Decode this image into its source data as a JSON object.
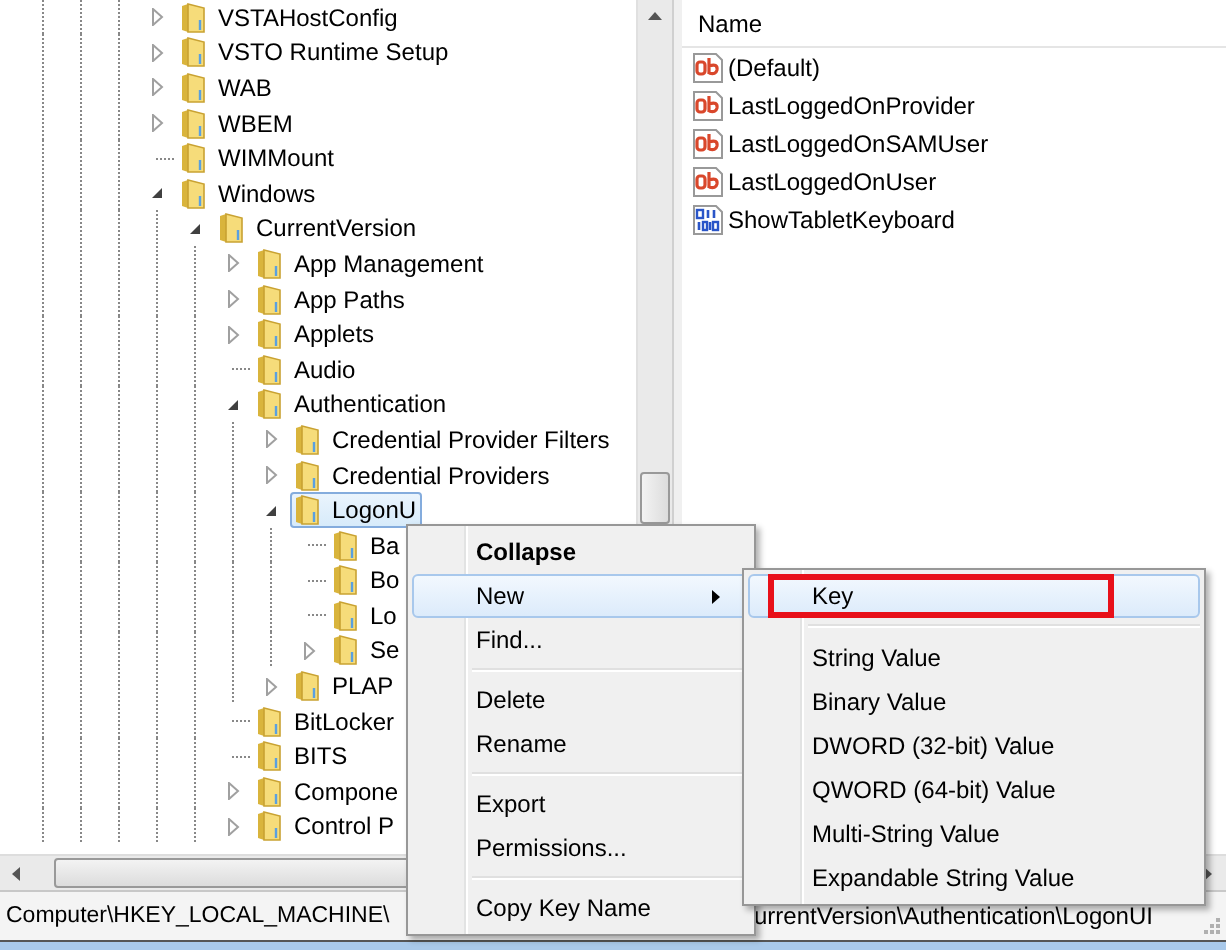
{
  "tree": [
    {
      "label": "VSTAHostConfig",
      "expanded": false,
      "selected": false
    },
    {
      "label": "VSTO Runtime Setup",
      "expanded": false,
      "selected": false
    },
    {
      "label": "WAB",
      "expanded": false,
      "selected": false
    },
    {
      "label": "WBEM",
      "expanded": false,
      "selected": false
    },
    {
      "label": "WIMMount",
      "selected": false
    },
    {
      "label": "Windows",
      "expanded": true,
      "selected": false,
      "children": [
        {
          "label": "CurrentVersion",
          "expanded": true,
          "selected": false,
          "children": [
            {
              "label": "App Management",
              "expanded": false,
              "selected": false
            },
            {
              "label": "App Paths",
              "expanded": false,
              "selected": false
            },
            {
              "label": "Applets",
              "expanded": false,
              "selected": false
            },
            {
              "label": "Audio",
              "selected": false
            },
            {
              "label": "Authentication",
              "expanded": true,
              "selected": false,
              "children": [
                {
                  "label": "Credential Provider Filters",
                  "expanded": false,
                  "selected": false
                },
                {
                  "label": "Credential Providers",
                  "expanded": false,
                  "selected": false
                },
                {
                  "label": "LogonU",
                  "expanded": true,
                  "selected": true,
                  "children": [
                    {
                      "label": "Ba",
                      "selected": false
                    },
                    {
                      "label": "Bo",
                      "selected": false
                    },
                    {
                      "label": "Lo",
                      "selected": false
                    },
                    {
                      "label": "Se",
                      "expanded": false,
                      "selected": false
                    }
                  ]
                },
                {
                  "label": "PLAP",
                  "expanded": false,
                  "selected": false
                }
              ]
            },
            {
              "label": "BitLocker",
              "selected": false
            },
            {
              "label": "BITS",
              "selected": false
            },
            {
              "label": "Compone",
              "expanded": false,
              "selected": false
            },
            {
              "label": "Control P",
              "expanded": false,
              "selected": false
            }
          ]
        }
      ]
    }
  ],
  "values": {
    "header": "Name",
    "rows": [
      {
        "name": "(Default)",
        "kind": "string"
      },
      {
        "name": "LastLoggedOnProvider",
        "kind": "string"
      },
      {
        "name": "LastLoggedOnSAMUser",
        "kind": "string"
      },
      {
        "name": "LastLoggedOnUser",
        "kind": "string"
      },
      {
        "name": "ShowTabletKeyboard",
        "kind": "dword"
      }
    ]
  },
  "context_menu": {
    "items": [
      {
        "kind": "item",
        "label": "Collapse",
        "default": true,
        "highlighted": false,
        "has_submenu": false
      },
      {
        "kind": "item",
        "label": "New",
        "default": false,
        "highlighted": true,
        "has_submenu": true
      },
      {
        "kind": "item",
        "label": "Find...",
        "default": false,
        "highlighted": false,
        "has_submenu": false
      },
      {
        "kind": "separator"
      },
      {
        "kind": "item",
        "label": "Delete",
        "default": false,
        "highlighted": false,
        "has_submenu": false
      },
      {
        "kind": "item",
        "label": "Rename",
        "default": false,
        "highlighted": false,
        "has_submenu": false
      },
      {
        "kind": "separator"
      },
      {
        "kind": "item",
        "label": "Export",
        "default": false,
        "highlighted": false,
        "has_submenu": false
      },
      {
        "kind": "item",
        "label": "Permissions...",
        "default": false,
        "highlighted": false,
        "has_submenu": false
      },
      {
        "kind": "separator"
      },
      {
        "kind": "item",
        "label": "Copy Key Name",
        "default": false,
        "highlighted": false,
        "has_submenu": false
      }
    ]
  },
  "submenu": {
    "items": [
      {
        "kind": "item",
        "label": "Key",
        "highlighted": true,
        "annotated": true
      },
      {
        "kind": "separator"
      },
      {
        "kind": "item",
        "label": "String Value",
        "highlighted": false,
        "annotated": false
      },
      {
        "kind": "item",
        "label": "Binary Value",
        "highlighted": false,
        "annotated": false
      },
      {
        "kind": "item",
        "label": "DWORD (32-bit) Value",
        "highlighted": false,
        "annotated": false
      },
      {
        "kind": "item",
        "label": "QWORD (64-bit) Value",
        "highlighted": false,
        "annotated": false
      },
      {
        "kind": "item",
        "label": "Multi-String Value",
        "highlighted": false,
        "annotated": false
      },
      {
        "kind": "item",
        "label": "Expandable String Value",
        "highlighted": false,
        "annotated": false
      }
    ]
  },
  "status_bar": {
    "visible_start": "Computer\\HKEY_LOCAL_MACHINE\\",
    "visible_end": "urrentVersion\\Authentication\\LogonUI"
  }
}
